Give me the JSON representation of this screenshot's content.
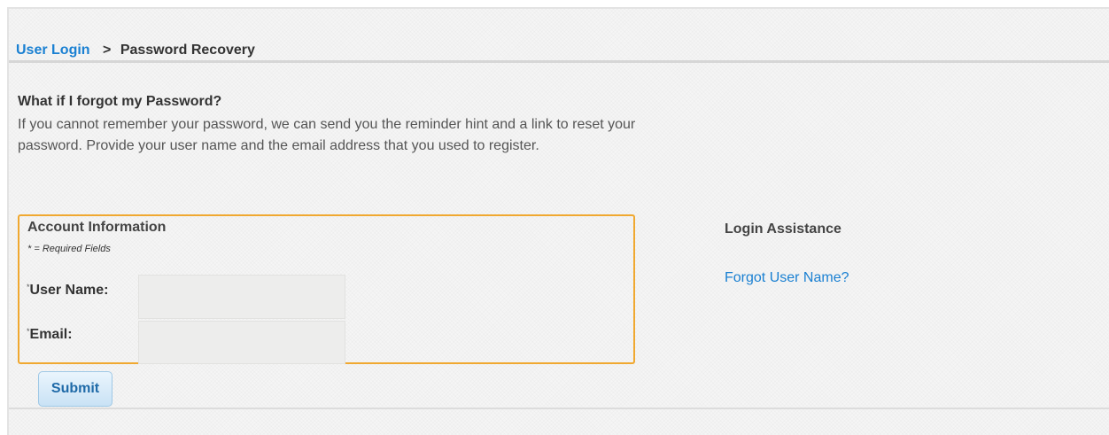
{
  "breadcrumb": {
    "link_label": "User Login",
    "separator": ">",
    "current": "Password Recovery"
  },
  "intro": {
    "heading": "What if I forgot my Password?",
    "text": "If you cannot remember your password, we can send you the reminder hint and a link to reset your password. Provide your user name and the email address that you used to register."
  },
  "account_form": {
    "title": "Account Information",
    "required_note": "* = Required Fields",
    "required_marker": "*",
    "username_label": "User Name:",
    "username_value": "",
    "email_label": "Email:",
    "email_value": "",
    "submit_label": "Submit"
  },
  "login_assistance": {
    "title": "Login Assistance",
    "forgot_username_link": "Forgot User Name?"
  },
  "colors": {
    "link": "#1a80d2",
    "fieldset_border": "#f0a830",
    "button_text": "#1f6aa8"
  }
}
